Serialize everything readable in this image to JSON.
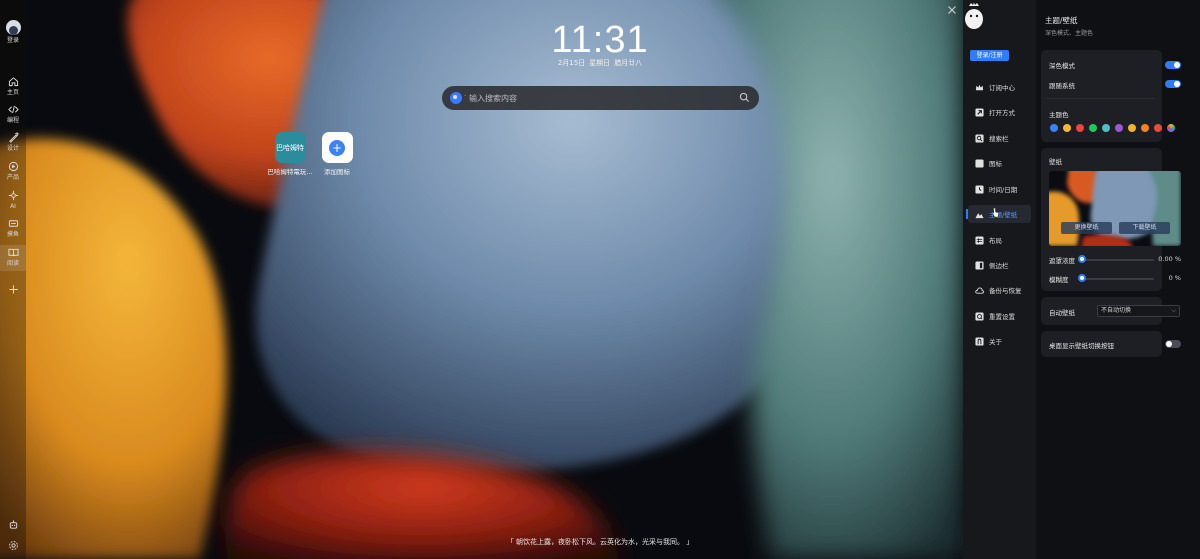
{
  "left_rail": {
    "user_label": "登录",
    "items": [
      {
        "label": "主页",
        "icon": "home-icon"
      },
      {
        "label": "编程",
        "icon": "code-icon"
      },
      {
        "label": "设计",
        "icon": "design-icon"
      },
      {
        "label": "产品",
        "icon": "product-icon"
      },
      {
        "label": "AI",
        "icon": "ai-icon"
      },
      {
        "label": "摸鱼",
        "icon": "fish-icon"
      },
      {
        "label": "阅读",
        "icon": "book-icon"
      }
    ],
    "add_icon": "plus-icon",
    "bottom_icons": [
      "robot-icon",
      "gear-icon"
    ]
  },
  "home": {
    "time": "11:31",
    "date": "2月15日",
    "weekday": "星期日",
    "lunar": "腊月廿八",
    "search": {
      "placeholder": "输入搜索内容",
      "separator": "·"
    },
    "tiles": [
      {
        "icon_text": "巴哈姆特",
        "label": "巴哈姆特電玩...",
        "color": "#2b8c9c"
      },
      {
        "icon_text": "+",
        "label": "添加图标",
        "color": "#ffffff"
      }
    ],
    "quote": "「 朝饮花上露，夜卧松下风。云英化为水，光采与我同。 」"
  },
  "settings": {
    "login_button": "登录/注册",
    "nav": [
      {
        "label": "订阅中心",
        "icon": "crown-icon"
      },
      {
        "label": "打开方式",
        "icon": "arrow-out-icon"
      },
      {
        "label": "搜索栏",
        "icon": "search-icon"
      },
      {
        "label": "图标",
        "icon": "square-icon"
      },
      {
        "label": "时间/日期",
        "icon": "clock-icon"
      },
      {
        "label": "主题/壁纸",
        "icon": "mountain-icon"
      },
      {
        "label": "布局",
        "icon": "layout-icon"
      },
      {
        "label": "侧边栏",
        "icon": "sidebar-icon"
      },
      {
        "label": "备份与恢复",
        "icon": "cloud-icon"
      },
      {
        "label": "重置设置",
        "icon": "reset-icon"
      },
      {
        "label": "关于",
        "icon": "info-icon"
      }
    ],
    "active_nav": 5,
    "page_title": "主题/壁纸",
    "page_subtitle": "深色模式、主题色",
    "dark_mode": {
      "label": "深色模式",
      "on": true
    },
    "follow_system": {
      "label": "跟随系统",
      "on": true
    },
    "theme_color": {
      "label": "主题色",
      "colors": [
        "#3b82f6",
        "#f5b82e",
        "#ef4444",
        "#22c55e",
        "#4ac2c2",
        "#9b59d0",
        "#f0b429",
        "#f58220",
        "#e74c3c",
        "#multicolor"
      ]
    },
    "wallpaper": {
      "label": "壁纸",
      "change_button": "更换壁纸",
      "download_button": "下载壁纸",
      "mask_label": "遮罩浓度",
      "mask_value": "0.00 %",
      "mask_level": 0,
      "blur_label": "模糊度",
      "blur_value": "0 %",
      "blur_level": 0
    },
    "auto_wallpaper": {
      "label": "自动壁纸",
      "selected": "不自动切换"
    },
    "desktop_switch": {
      "label": "桌面显示壁纸切换按钮",
      "on": false
    }
  }
}
